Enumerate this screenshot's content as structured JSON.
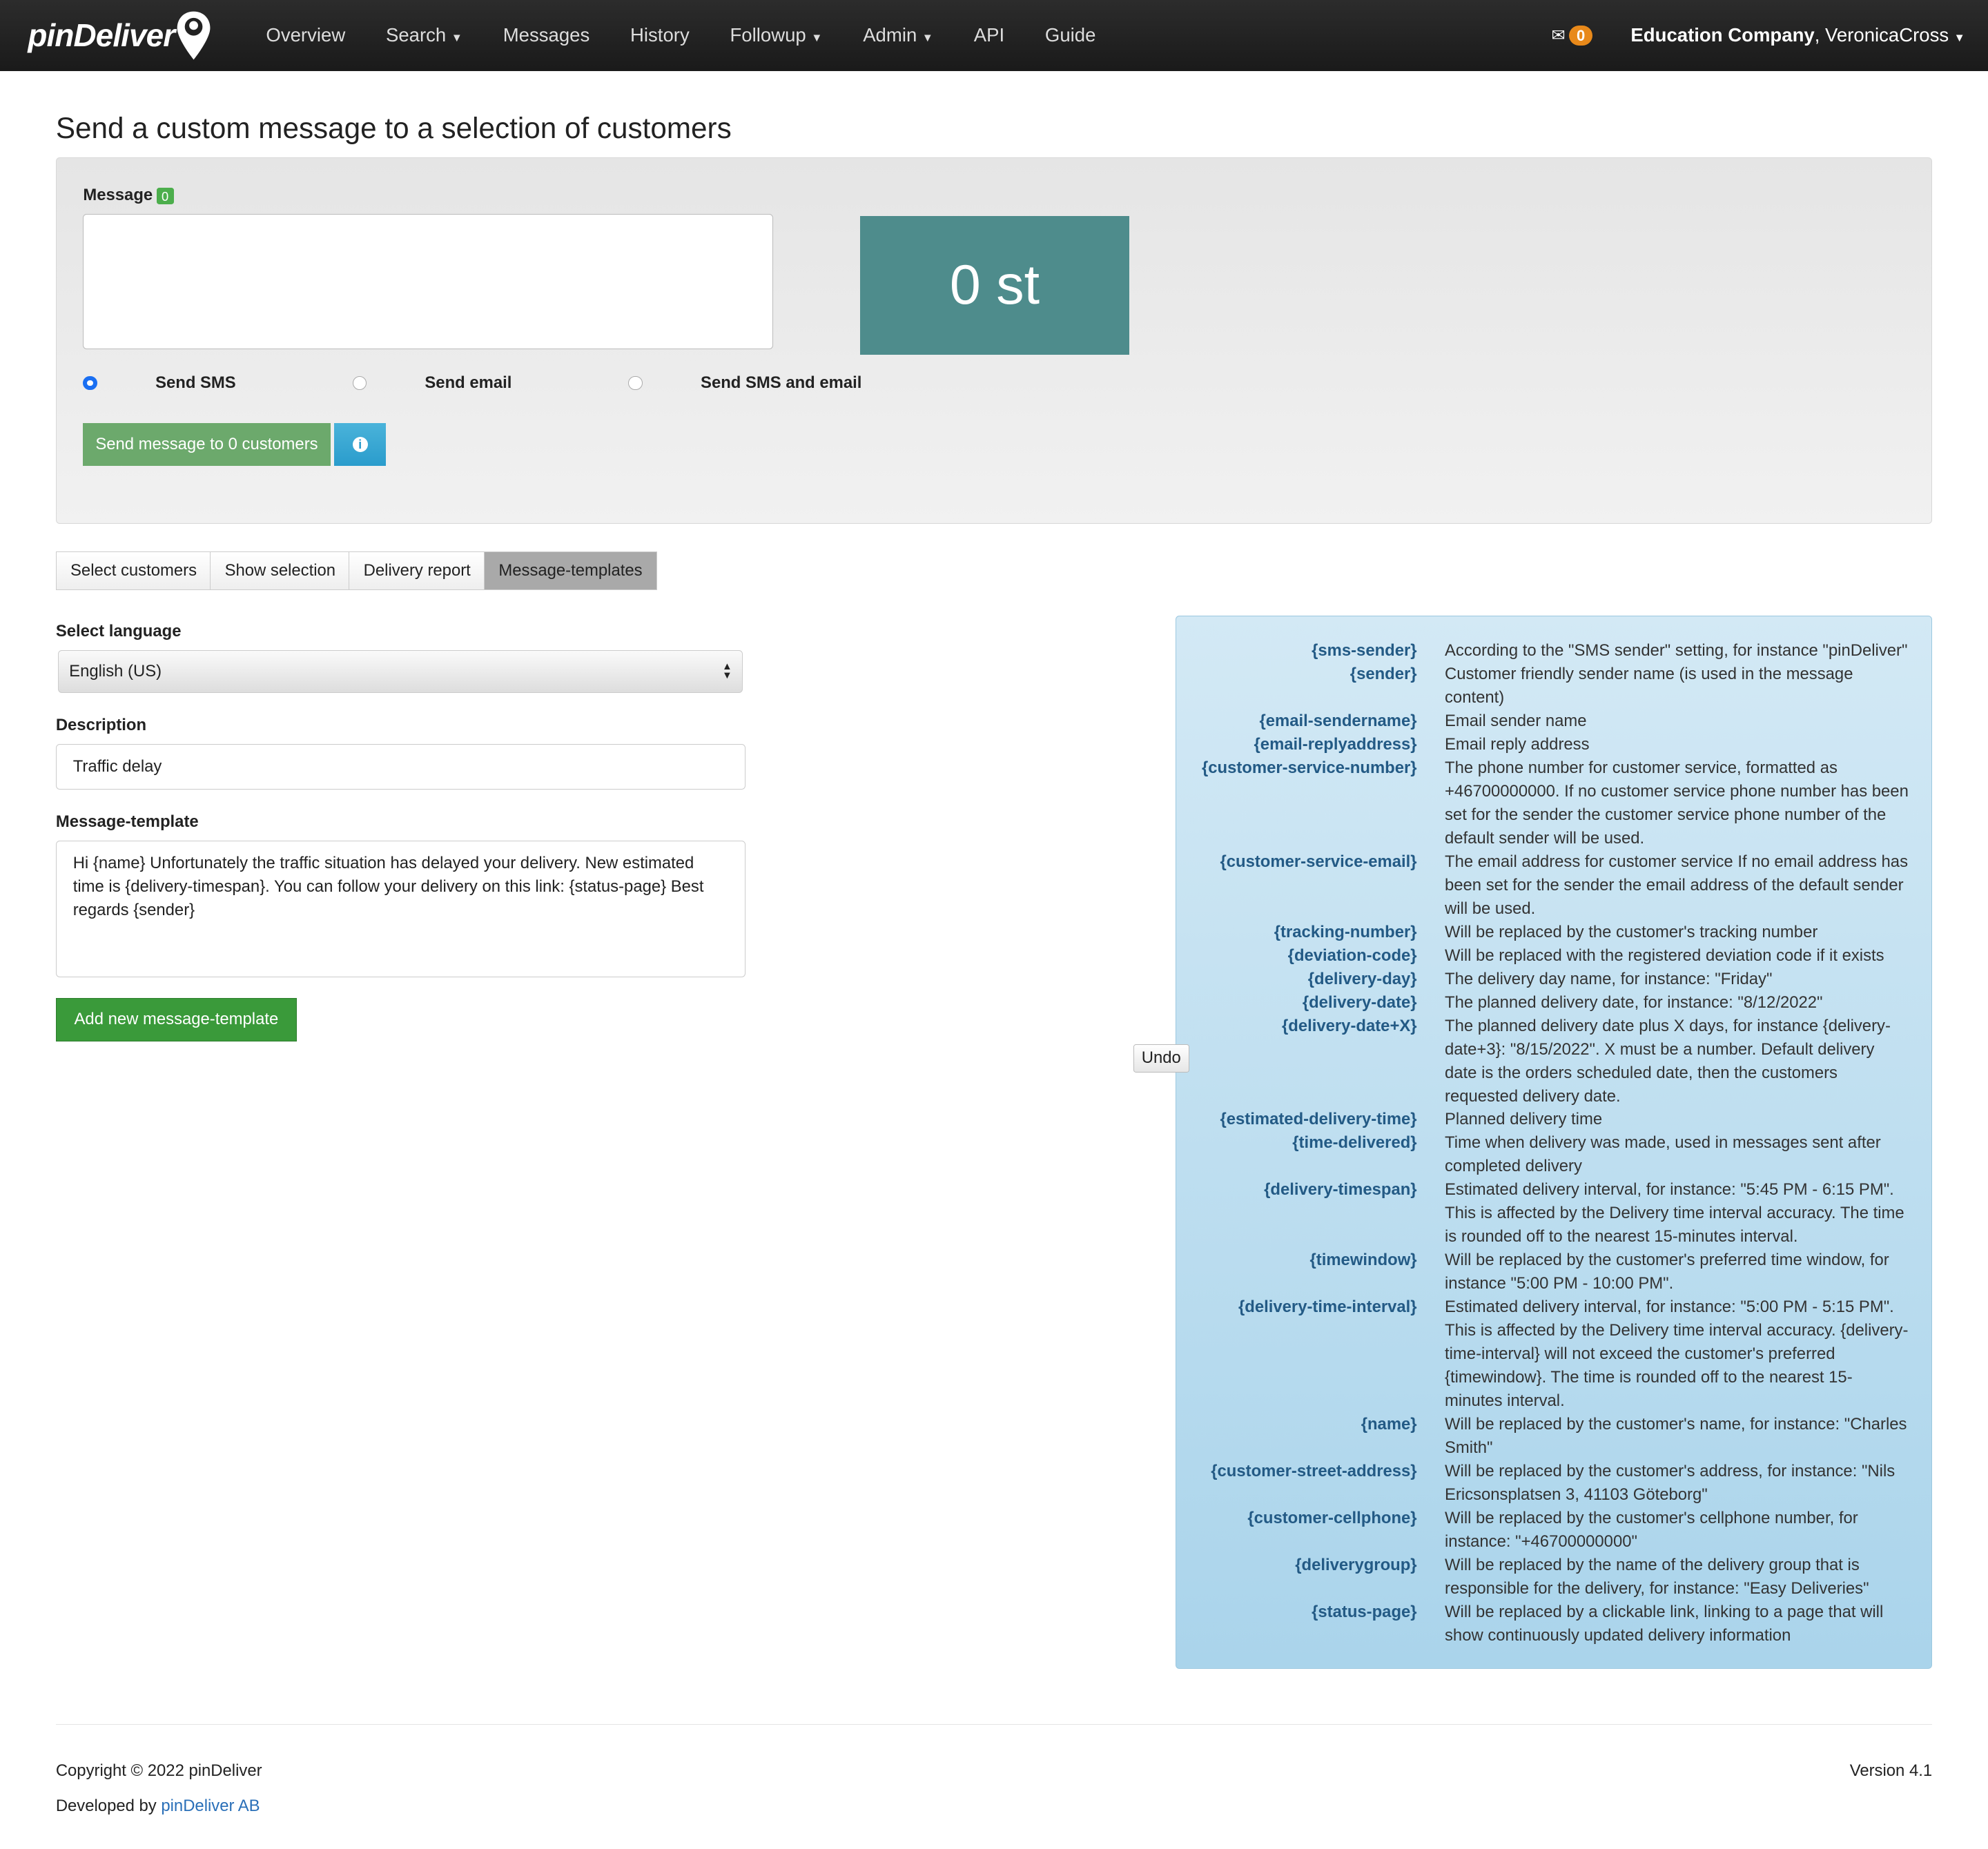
{
  "nav": {
    "brand": "pinDeliver",
    "items": [
      {
        "label": "Overview",
        "dropdown": false
      },
      {
        "label": "Search",
        "dropdown": true
      },
      {
        "label": "Messages",
        "dropdown": false
      },
      {
        "label": "History",
        "dropdown": false
      },
      {
        "label": "Followup",
        "dropdown": true
      },
      {
        "label": "Admin",
        "dropdown": true
      },
      {
        "label": "API",
        "dropdown": false
      },
      {
        "label": "Guide",
        "dropdown": false
      }
    ],
    "mail_count": "0",
    "company": "Education Company",
    "user": ", VeronicaCross"
  },
  "page_title": "Send a custom message to a selection of customers",
  "composer": {
    "message_label": "Message",
    "char_count": "0",
    "message_value": "",
    "counter": "0 st",
    "radios": [
      {
        "label": "Send SMS",
        "checked": true
      },
      {
        "label": "Send email",
        "checked": false
      },
      {
        "label": "Send SMS and email",
        "checked": false
      }
    ],
    "send_label": "Send message to 0 customers"
  },
  "tabs": [
    {
      "label": "Select customers",
      "active": false
    },
    {
      "label": "Show selection",
      "active": false
    },
    {
      "label": "Delivery report",
      "active": false
    },
    {
      "label": "Message-templates",
      "active": true
    }
  ],
  "form": {
    "language_label": "Select language",
    "language_value": "English (US)",
    "description_label": "Description",
    "description_value": "Traffic delay",
    "template_label": "Message-template",
    "template_value": "Hi {name} Unfortunately the traffic situation has delayed your delivery. New estimated time is {delivery-timespan}. You can follow your delivery on this link: {status-page} Best regards {sender}",
    "add_label": "Add new message-template",
    "undo_label": "Undo"
  },
  "placeholders": [
    {
      "key": "{sms-sender}",
      "desc": "According to the \"SMS sender\" setting, for instance \"pinDeliver\""
    },
    {
      "key": "{sender}",
      "desc": "Customer friendly sender name (is used in the message content)"
    },
    {
      "key": "{email-sendername}",
      "desc": "Email sender name"
    },
    {
      "key": "{email-replyaddress}",
      "desc": "Email reply address"
    },
    {
      "key": "{customer-service-number}",
      "desc": "The phone number for customer service, formatted as +46700000000. If no customer service phone number has been set for the sender the customer service phone number of the default sender will be used."
    },
    {
      "key": "{customer-service-email}",
      "desc": "The email address for customer service If no email address has been set for the sender the email address of the default sender will be used."
    },
    {
      "key": "{tracking-number}",
      "desc": "Will be replaced by the customer's tracking number"
    },
    {
      "key": "{deviation-code}",
      "desc": "Will be replaced with the registered deviation code if it exists"
    },
    {
      "key": "{delivery-day}",
      "desc": "The delivery day name, for instance: \"Friday\""
    },
    {
      "key": "{delivery-date}",
      "desc": "The planned delivery date, for instance: \"8/12/2022\""
    },
    {
      "key": "{delivery-date+X}",
      "desc": "The planned delivery date plus X days, for instance {delivery-date+3}: \"8/15/2022\". X must be a number. Default delivery date is the orders scheduled date, then the customers requested delivery date."
    },
    {
      "key": "{estimated-delivery-time}",
      "desc": "Planned delivery time"
    },
    {
      "key": "{time-delivered}",
      "desc": "Time when delivery was made, used in messages sent after completed delivery"
    },
    {
      "key": "{delivery-timespan}",
      "desc": "Estimated delivery interval, for instance: \"5:45 PM - 6:15 PM\". This is affected by the Delivery time interval accuracy. The time is rounded off to the nearest 15-minutes interval."
    },
    {
      "key": "{timewindow}",
      "desc": "Will be replaced by the customer's preferred time window, for instance \"5:00 PM - 10:00 PM\"."
    },
    {
      "key": "{delivery-time-interval}",
      "desc": "Estimated delivery interval, for instance: \"5:00 PM - 5:15 PM\". This is affected by the Delivery time interval accuracy. {delivery-time-interval} will not exceed the customer's preferred {timewindow}. The time is rounded off to the nearest 15-minutes interval."
    },
    {
      "key": "{name}",
      "desc": "Will be replaced by the customer's name, for instance: \"Charles Smith\""
    },
    {
      "key": "{customer-street-address}",
      "desc": "Will be replaced by the customer's address, for instance: \"Nils Ericsonsplatsen 3, 41103 Göteborg\""
    },
    {
      "key": "{customer-cellphone}",
      "desc": "Will be replaced by the customer's cellphone number, for instance: \"+46700000000\""
    },
    {
      "key": "{deliverygroup}",
      "desc": "Will be replaced by the name of the delivery group that is responsible for the delivery, for instance: \"Easy Deliveries\""
    },
    {
      "key": "{status-page}",
      "desc": "Will be replaced by a clickable link, linking to a page that will show continuously updated delivery information"
    }
  ],
  "footer": {
    "copyright": "Copyright © 2022 pinDeliver",
    "developed": "Developed by ",
    "developer": "pinDeliver AB",
    "version": "Version 4.1"
  },
  "colors": {
    "nav": "#1f1f1f",
    "counter": "#4e8c8c",
    "send": "#6ca96c",
    "info": "#2a9ccc",
    "add": "#3a9a3a",
    "badge": "#e8891a"
  }
}
